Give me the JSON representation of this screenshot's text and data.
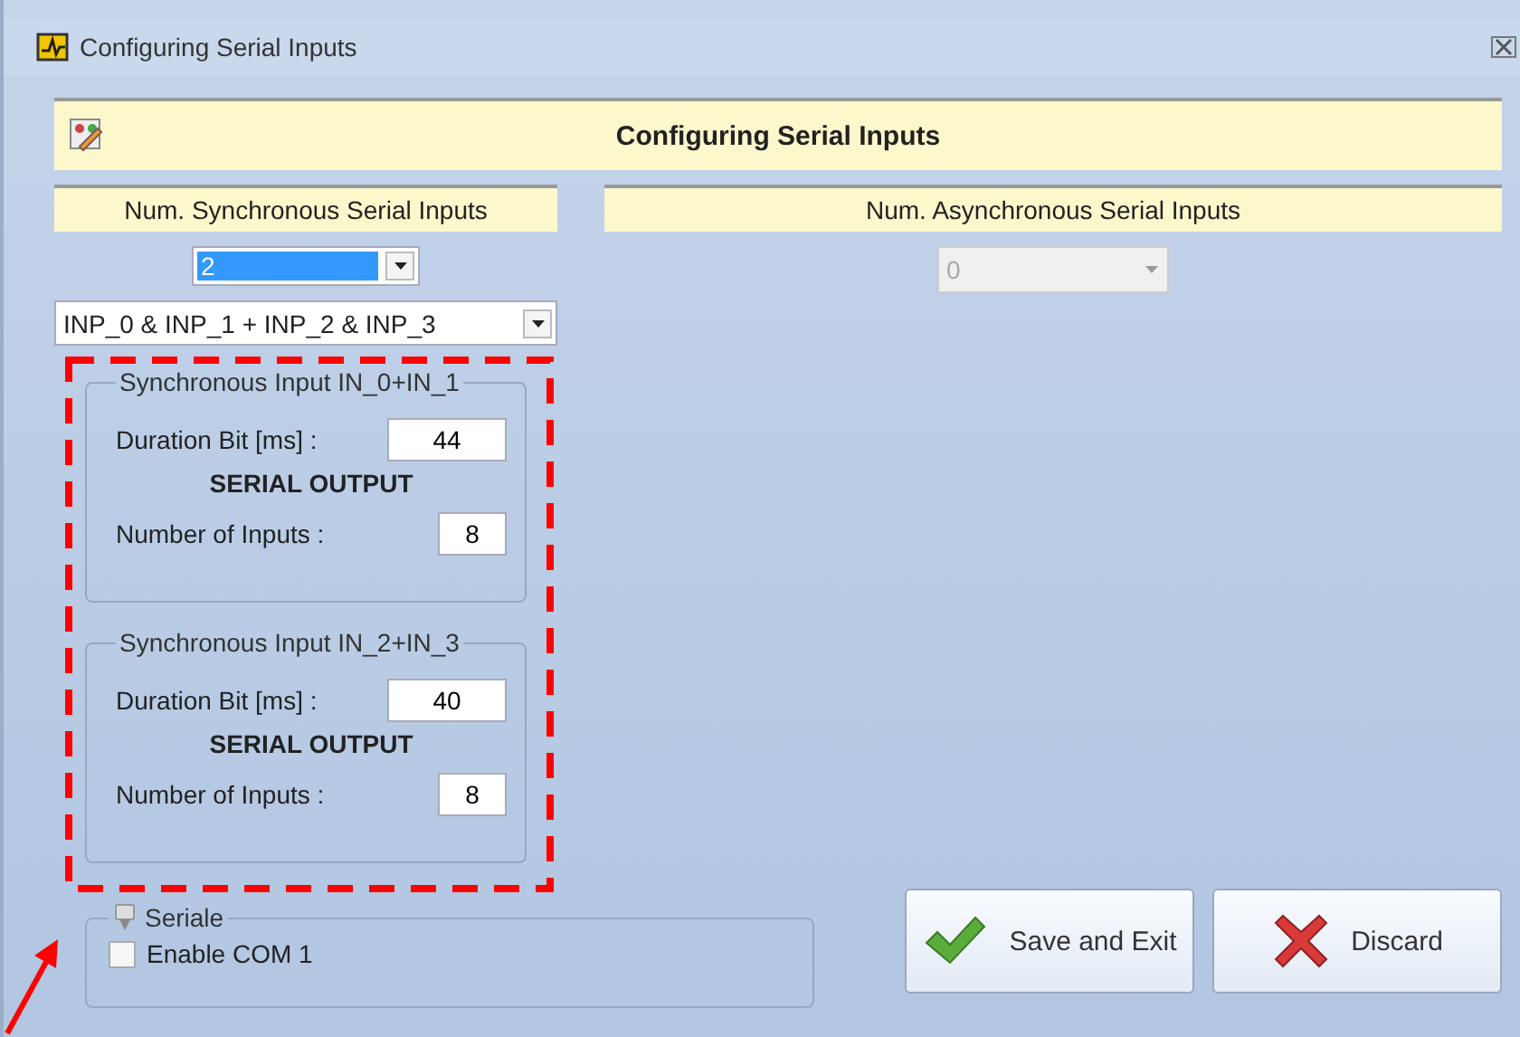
{
  "window": {
    "title": "Configuring Serial Inputs"
  },
  "banner": {
    "title": "Configuring Serial Inputs"
  },
  "sync": {
    "header": "Num. Synchronous Serial Inputs",
    "count": {
      "value": "2",
      "highlighted": true,
      "disabled": false
    },
    "pairing": {
      "value": "INP_0 & INP_1 + INP_2 & INP_3",
      "disabled": false
    }
  },
  "async": {
    "header": "Num. Asynchronous Serial Inputs",
    "count": {
      "value": "0",
      "highlighted": false,
      "disabled": true
    }
  },
  "groups": [
    {
      "title": "Synchronous Input IN_0+IN_1",
      "duration_label": "Duration Bit [ms] :",
      "duration_value": "44",
      "section": "SERIAL OUTPUT",
      "inputs_label": "Number of Inputs :",
      "inputs_value": "8"
    },
    {
      "title": "Synchronous Input IN_2+IN_3",
      "duration_label": "Duration Bit [ms] :",
      "duration_value": "40",
      "section": "SERIAL OUTPUT",
      "inputs_label": "Number of Inputs :",
      "inputs_value": "8"
    }
  ],
  "serial": {
    "title": "Seriale",
    "checkbox": {
      "label": "Enable COM 1",
      "checked": false
    }
  },
  "buttons": [
    {
      "label": "Save and Exit",
      "kind": "save"
    },
    {
      "label": "Discard",
      "kind": "discard"
    }
  ]
}
